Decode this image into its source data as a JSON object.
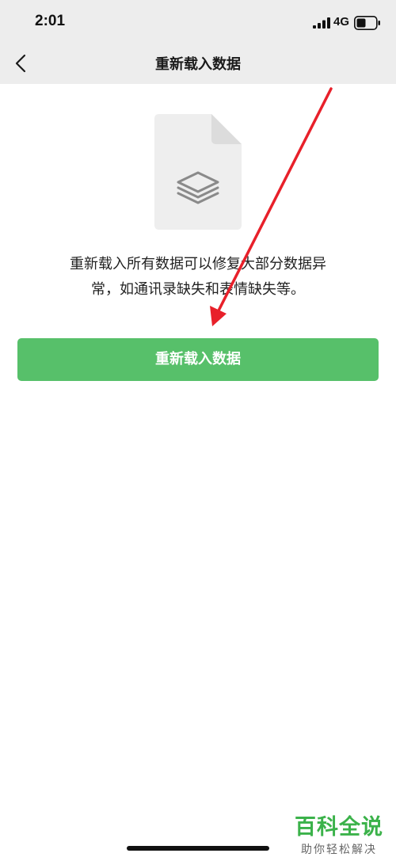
{
  "status_bar": {
    "time": "2:01",
    "network": "4G",
    "icons": [
      "signal-bars-icon",
      "battery-icon"
    ]
  },
  "nav": {
    "back_icon": "chevron-left-icon",
    "title": "重新载入数据"
  },
  "illustration": {
    "icon": "stacked-layers-icon",
    "doc_color": "#eeeeee",
    "fold_color": "#dcdcdc",
    "layers_color": "#8a8a8a"
  },
  "description": {
    "line1": "重新载入所有数据可以修复大部分数据异",
    "line2": "常，如通讯录缺失和表情缺失等。"
  },
  "action": {
    "reload_label": "重新载入数据",
    "button_color": "#57c06a"
  },
  "annotation": {
    "arrow_color": "#e8202a"
  },
  "watermark": {
    "title": "百科全说",
    "subtitle": "助你轻松解决",
    "color": "#3bb24a"
  }
}
